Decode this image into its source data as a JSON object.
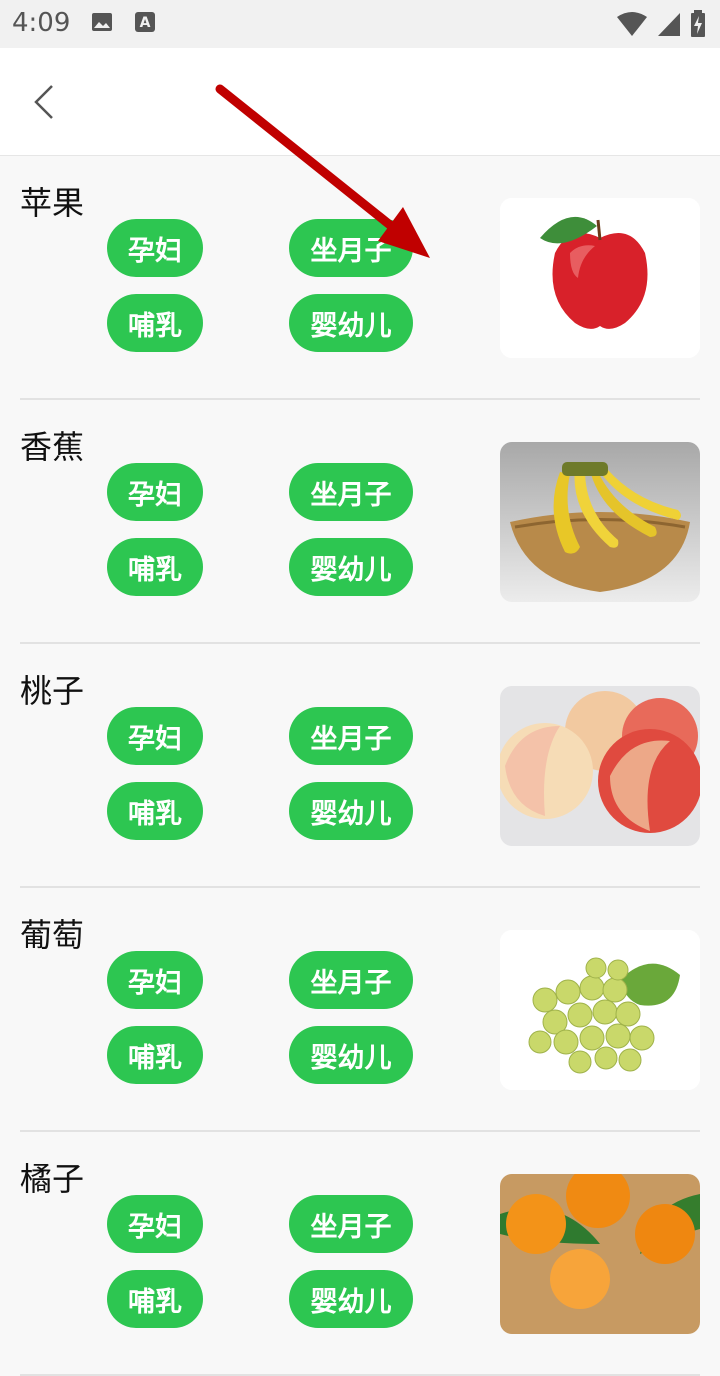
{
  "status": {
    "time": "4:09",
    "icons": [
      "image-icon",
      "text-a-icon",
      "wifi-icon",
      "signal-icon",
      "battery-icon"
    ]
  },
  "header": {
    "back_icon": "chevron-left-icon"
  },
  "tags": [
    "孕妇",
    "坐月子",
    "哺乳",
    "婴幼儿"
  ],
  "items": [
    {
      "name": "苹果",
      "image": "apple"
    },
    {
      "name": "香蕉",
      "image": "banana"
    },
    {
      "name": "桃子",
      "image": "peach"
    },
    {
      "name": "葡萄",
      "image": "grape"
    },
    {
      "name": "橘子",
      "image": "orange"
    }
  ],
  "colors": {
    "tag_green": "#2dc651",
    "arrow_red": "#c00000"
  }
}
